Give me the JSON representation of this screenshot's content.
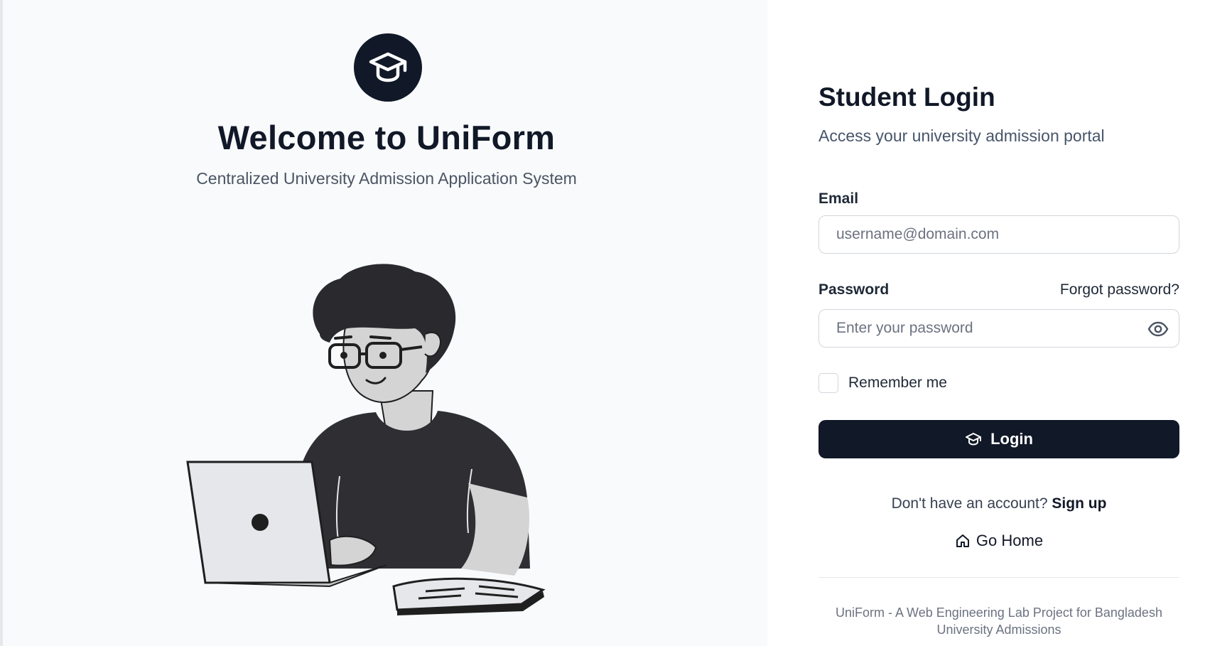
{
  "brand": {
    "logo_icon": "graduation-cap-icon",
    "title": "Welcome to UniForm",
    "subtitle": "Centralized University Admission Application System",
    "illustration": "student-with-laptop-illustration"
  },
  "login": {
    "title": "Student Login",
    "subtitle": "Access your university admission portal",
    "email_label": "Email",
    "email_placeholder": "username@domain.com",
    "email_value": "",
    "password_label": "Password",
    "forgot_link": "Forgot password?",
    "password_placeholder": "Enter your password",
    "password_value": "",
    "password_toggle_icon": "eye-icon",
    "remember_label": "Remember me",
    "remember_checked": false,
    "login_button": "Login",
    "login_icon": "graduation-cap-icon",
    "signup_prompt": "Don't have an account?",
    "signup_link": "Sign up",
    "home_link": "Go Home",
    "home_icon": "home-icon",
    "footer": "UniForm - A Web Engineering Lab Project for Bangladesh University Admissions"
  },
  "colors": {
    "primary": "#111827",
    "left_background": "#f8fafc",
    "muted_text": "#6b7280",
    "border": "#d1d5db"
  }
}
